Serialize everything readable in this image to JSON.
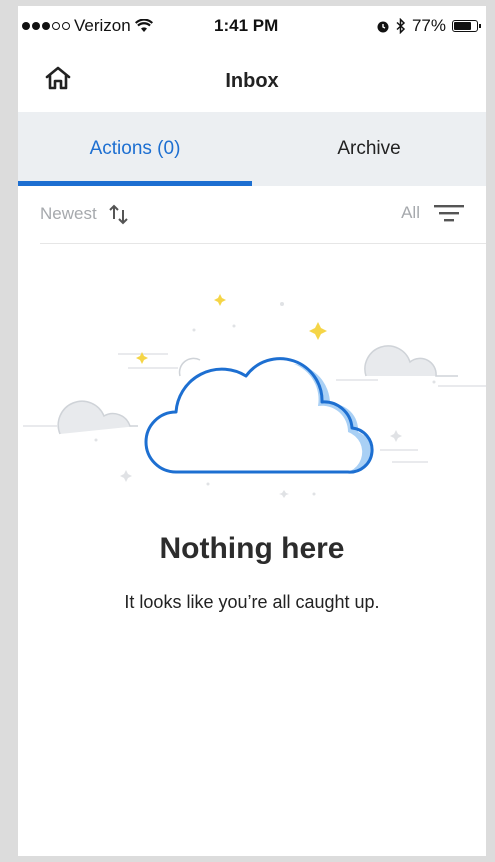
{
  "status_bar": {
    "carrier": "Verizon",
    "time": "1:41 PM",
    "battery_percent_label": "77%",
    "battery_level": 0.77,
    "icons": [
      "signal-dots-icon",
      "wifi-icon",
      "alarm-icon",
      "bluetooth-icon",
      "battery-icon"
    ]
  },
  "header": {
    "title": "Inbox",
    "home_icon": "home-icon"
  },
  "tabs": [
    {
      "label": "Actions (0)",
      "active": true
    },
    {
      "label": "Archive",
      "active": false
    }
  ],
  "filters": {
    "sort_label": "Newest",
    "sort_icon": "sort-arrows-icon",
    "filter_label": "All",
    "filter_icon": "filter-lines-icon"
  },
  "empty_state": {
    "title": "Nothing here",
    "subtitle": "It looks like you’re all caught up.",
    "illustration_icon": "cloud-illustration"
  },
  "colors": {
    "accent": "#1d6fd1",
    "tab_bar_bg": "#eceff2",
    "sparkle": "#f5d547",
    "cloud_fill": "#a9d0f5"
  }
}
